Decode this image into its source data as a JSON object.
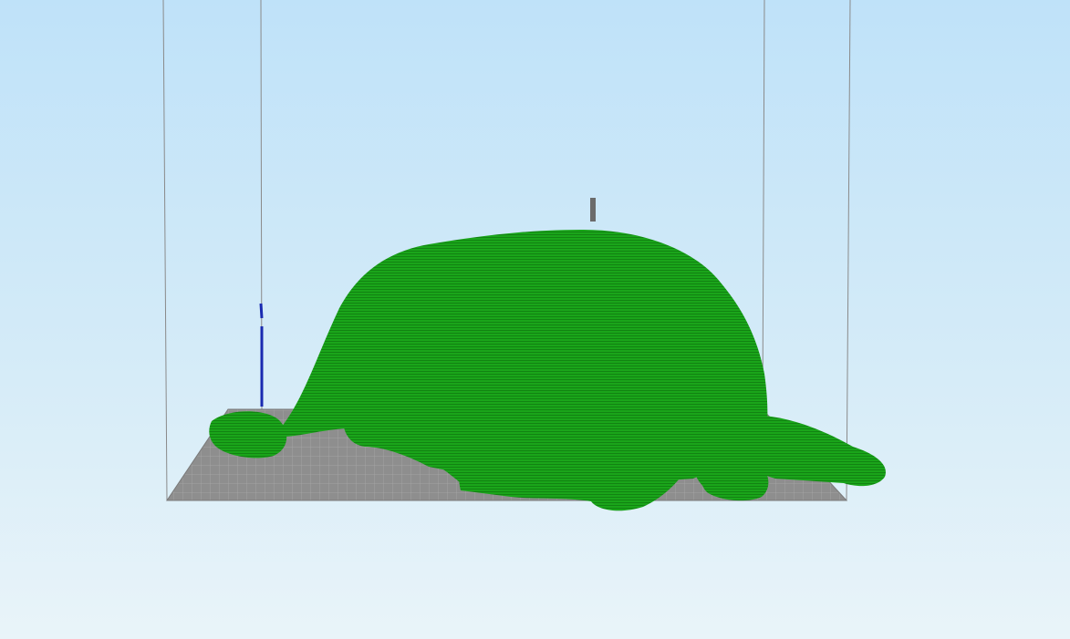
{
  "viewport": {
    "background_top": "#bfe2f9",
    "background_bottom": "#e9f4f9"
  },
  "build_plate": {
    "color": "#8e8e8e",
    "grid_color": "#a9a9a9"
  },
  "model": {
    "type": "sliced-3d-model",
    "subject": "sleeping-dog",
    "color": "#1aa51a",
    "layer_line_color": "#0f7a0f"
  },
  "toolpath_markers": {
    "travel_color": "#1a2ab0",
    "nozzle_color": "#6b6b6b"
  }
}
